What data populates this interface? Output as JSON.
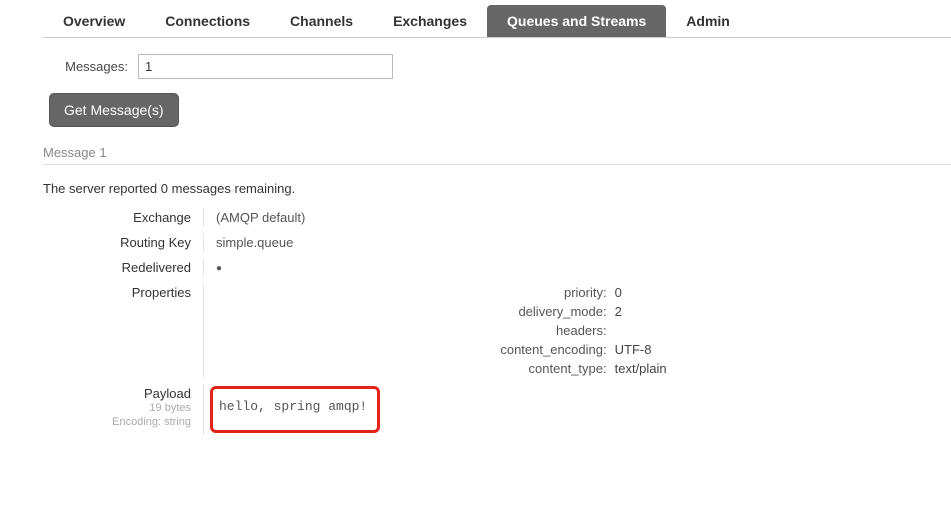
{
  "tabs": {
    "overview": "Overview",
    "connections": "Connections",
    "channels": "Channels",
    "exchanges": "Exchanges",
    "queues": "Queues and Streams",
    "admin": "Admin"
  },
  "form": {
    "messages_label": "Messages:",
    "messages_value": "1",
    "get_button": "Get Message(s)"
  },
  "message": {
    "heading": "Message 1",
    "remaining_prefix": "The server reported ",
    "remaining_count": "0",
    "remaining_suffix": " messages remaining.",
    "exchange_label": "Exchange",
    "exchange_value": "(AMQP default)",
    "routing_label": "Routing Key",
    "routing_value": "simple.queue",
    "redelivered_label": "Redelivered",
    "redelivered_value": "●",
    "properties_label": "Properties",
    "props": {
      "priority_k": "priority:",
      "priority_v": "0",
      "delivery_k": "delivery_mode:",
      "delivery_v": "2",
      "headers_k": "headers:",
      "headers_v": "",
      "enc_k": "content_encoding:",
      "enc_v": "UTF-8",
      "type_k": "content_type:",
      "type_v": "text/plain"
    },
    "payload_label": "Payload",
    "payload_size": "19 bytes",
    "payload_enc": "Encoding: string",
    "payload": "hello, spring amqp!"
  }
}
